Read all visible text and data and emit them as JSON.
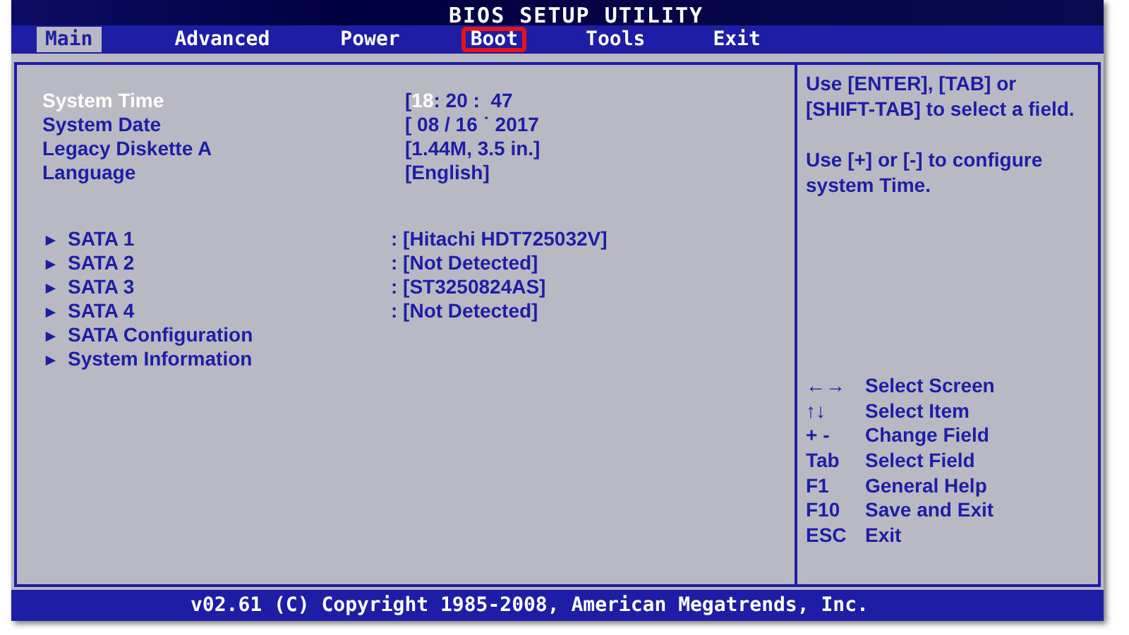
{
  "title": "BIOS SETUP UTILITY",
  "tabs": [
    {
      "label": "Main",
      "selected": true,
      "outlined": false
    },
    {
      "label": "Advanced",
      "selected": false,
      "outlined": false
    },
    {
      "label": "Power",
      "selected": false,
      "outlined": false
    },
    {
      "label": "Boot",
      "selected": false,
      "outlined": true
    },
    {
      "label": "Tools",
      "selected": false,
      "outlined": false
    },
    {
      "label": "Exit",
      "selected": false,
      "outlined": false
    }
  ],
  "settings": [
    {
      "label": "System Time",
      "selected": true,
      "value": [
        {
          "text": "[",
          "selected": false
        },
        {
          "text": "18",
          "selected": true
        },
        {
          "text": ": 20 :  47",
          "selected": false
        }
      ]
    },
    {
      "label": "System Date",
      "selected": false,
      "value": [
        {
          "text": "[ 08 / 16 ˙ 2017",
          "selected": false
        }
      ]
    },
    {
      "label": "Legacy Diskette A",
      "selected": false,
      "value": [
        {
          "text": "[1.44M, 3.5 in.]",
          "selected": false
        }
      ]
    },
    {
      "label": "Language",
      "selected": false,
      "value": [
        {
          "text": "[English]",
          "selected": false
        }
      ]
    }
  ],
  "submenus": [
    {
      "marker": "►",
      "label": "SATA 1",
      "value": ": [Hitachi HDT725032V]"
    },
    {
      "marker": "►",
      "label": "SATA 2",
      "value": ": [Not Detected]"
    },
    {
      "marker": "►",
      "label": "SATA 3",
      "value": ": [ST3250824AS]"
    },
    {
      "marker": "►",
      "label": "SATA 4",
      "value": ": [Not Detected]"
    },
    {
      "marker": "►",
      "label": "SATA Configuration"
    },
    {
      "marker": "►",
      "label": "System Information"
    }
  ],
  "help": [
    "Use [ENTER], [TAB] or [SHIFT-TAB] to select a field.",
    "Use [+] or [-] to configure system Time."
  ],
  "keys": [
    {
      "key": "←→",
      "action": "Select Screen"
    },
    {
      "key": "↑↓",
      "action": "Select Item"
    },
    {
      "key": "+ -",
      "action": "Change Field"
    },
    {
      "key": "Tab",
      "action": "Select Field"
    },
    {
      "key": "F1",
      "action": "General Help"
    },
    {
      "key": "F10",
      "action": "Save and Exit"
    },
    {
      "key": "ESC",
      "action": "Exit"
    }
  ],
  "footer": "v02.61 (C) Copyright 1985-2008, American Megatrends, Inc."
}
